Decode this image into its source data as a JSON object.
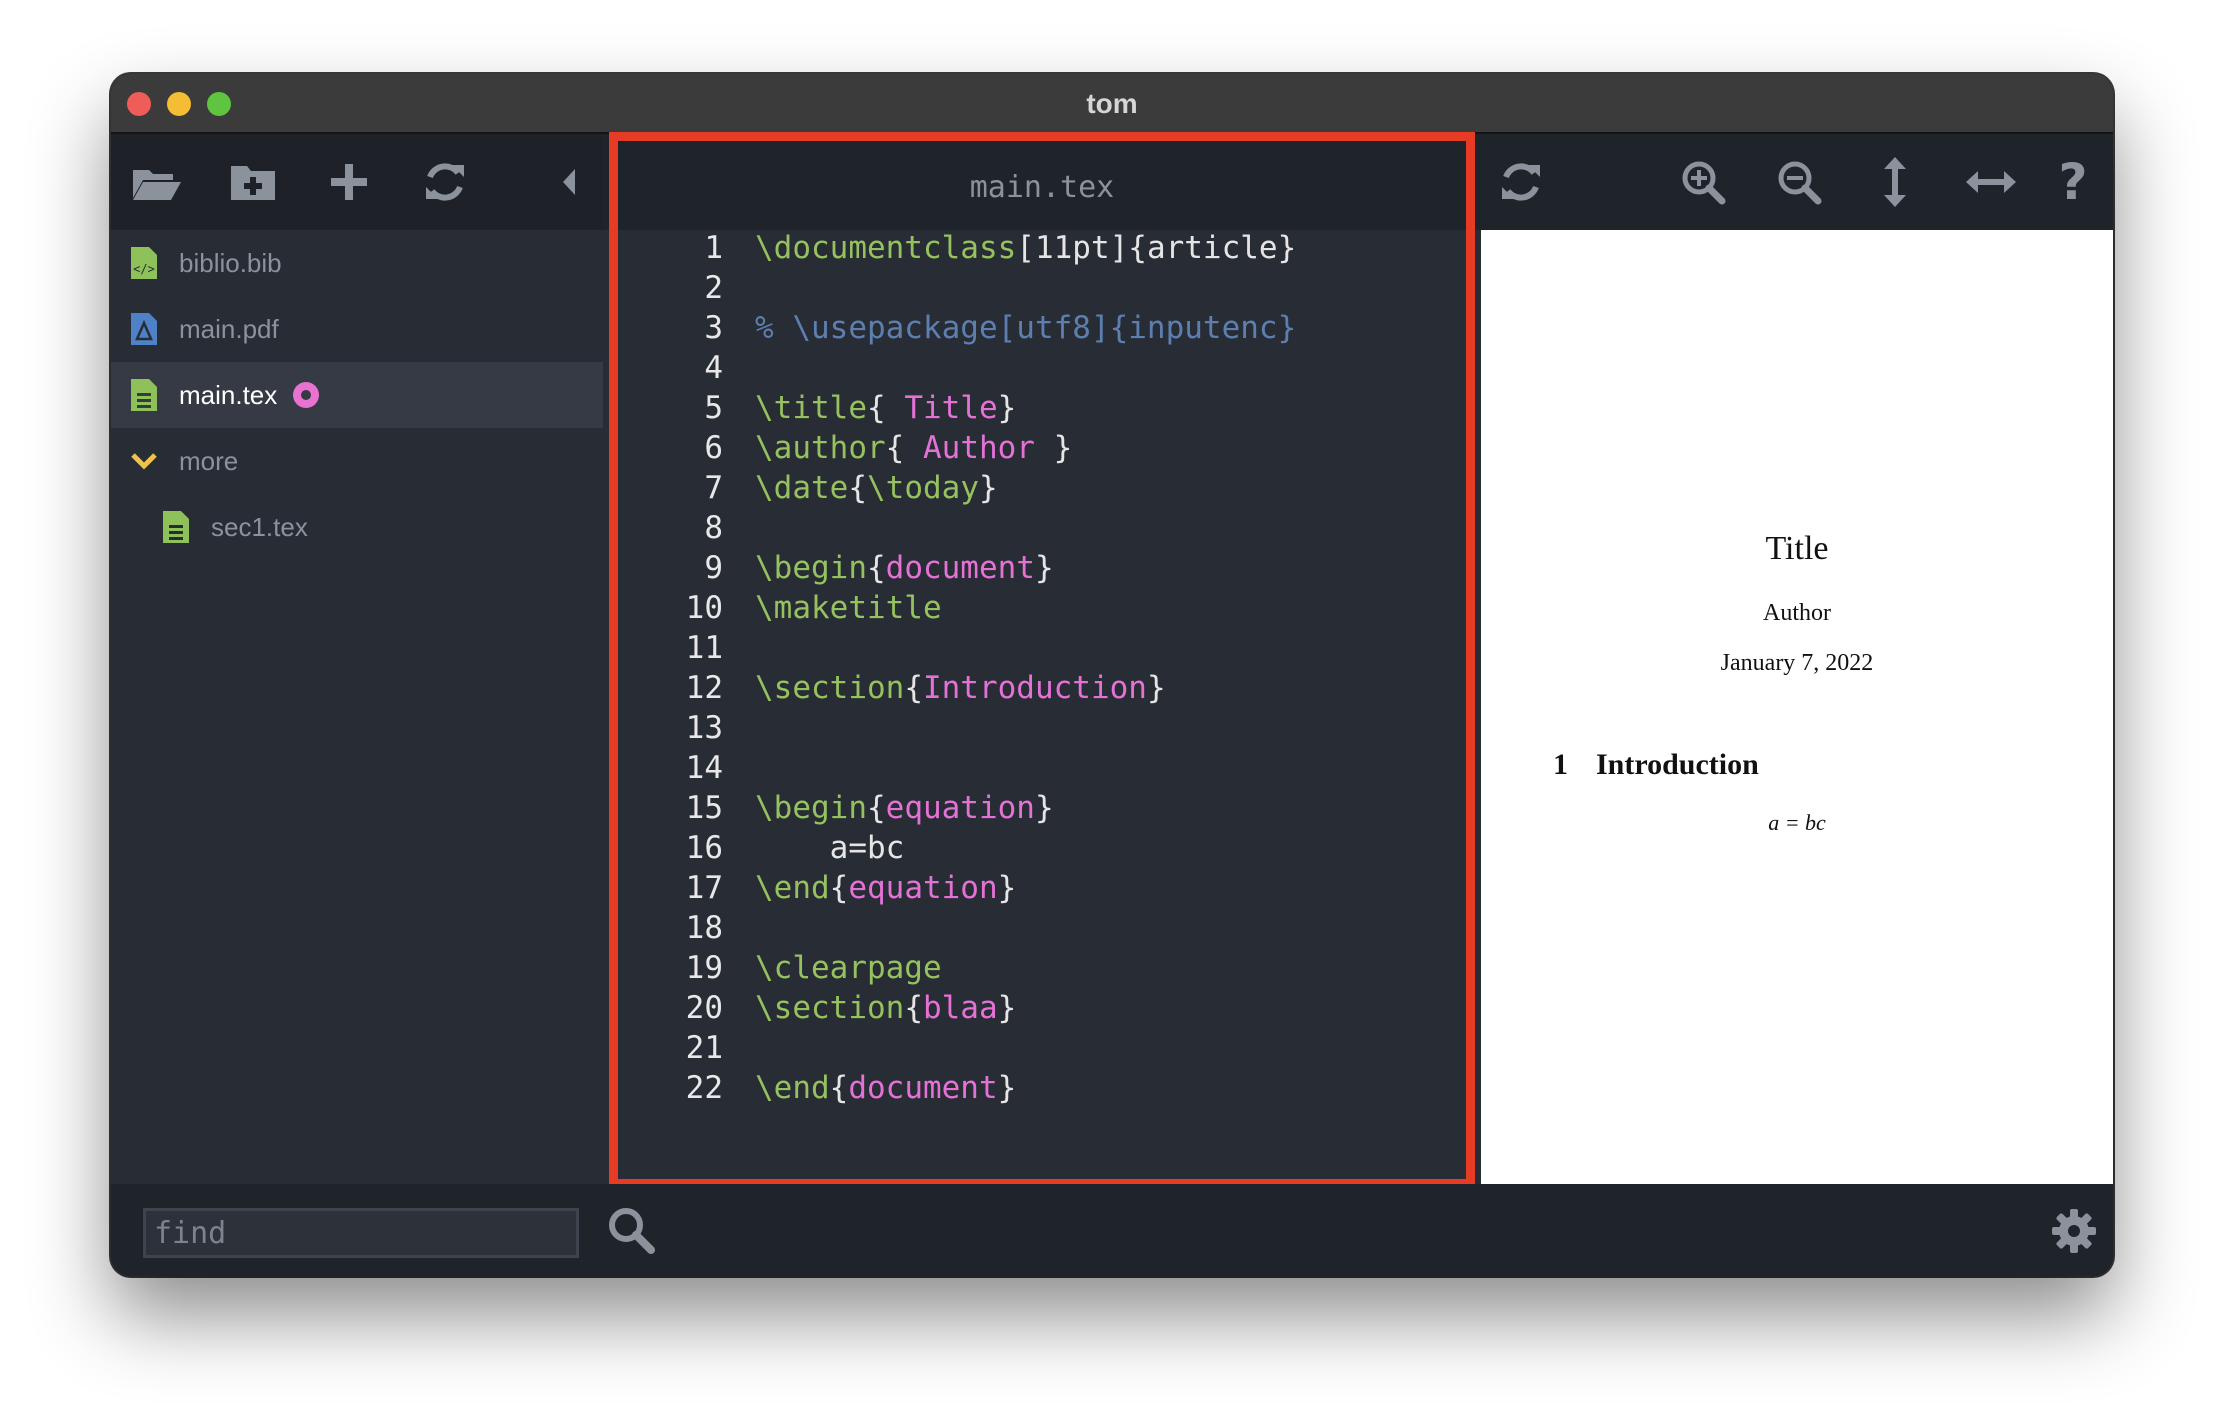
{
  "window": {
    "title": "tom"
  },
  "sidebar": {
    "toolbar": [
      {
        "name": "open-folder-icon"
      },
      {
        "name": "add-folder-icon"
      },
      {
        "name": "add-icon"
      },
      {
        "name": "refresh-icon"
      },
      {
        "name": "collapse-arrow-icon"
      }
    ],
    "files": [
      {
        "label": "biblio.bib",
        "icon": "bib-file-icon",
        "color": "#8fc15a"
      },
      {
        "label": "main.pdf",
        "icon": "pdf-file-icon",
        "color": "#4f81c7"
      },
      {
        "label": "main.tex",
        "icon": "tex-file-icon",
        "color": "#8fc15a",
        "active": true,
        "modified": true
      },
      {
        "label": "more",
        "icon": "chevron-down-icon",
        "color": "#f0c14b"
      },
      {
        "label": "sec1.tex",
        "icon": "tex-file-icon",
        "color": "#8fc15a"
      }
    ]
  },
  "editor": {
    "tab": "main.tex",
    "lines": [
      "1",
      "2",
      "3",
      "4",
      "5",
      "6",
      "7",
      "8",
      "9",
      "10",
      "11",
      "12",
      "13",
      "14",
      "15",
      "16",
      "17",
      "18",
      "19",
      "20",
      "21",
      "22"
    ],
    "code": {
      "l1": [
        "\\documentclass",
        "[11pt]{article}"
      ],
      "l3": "% \\usepackage[utf8]{inputenc}",
      "l5": [
        "\\title",
        "{",
        " Title",
        "}"
      ],
      "l6": [
        "\\author",
        "{",
        " Author",
        " }"
      ],
      "l7": [
        "\\date",
        "{",
        "\\today",
        "}"
      ],
      "l9": [
        "\\begin",
        "{",
        "document",
        "}"
      ],
      "l10": "\\maketitle",
      "l12": [
        "\\section",
        "{",
        "Introduction",
        "}"
      ],
      "l15": [
        "\\begin",
        "{",
        "equation",
        "}"
      ],
      "l16": "    a=bc",
      "l17": [
        "\\end",
        "{",
        "equation",
        "}"
      ],
      "l19": "\\clearpage",
      "l20": [
        "\\section",
        "{",
        "blaa",
        "}"
      ],
      "l22": [
        "\\end",
        "{",
        "document",
        "}"
      ]
    }
  },
  "preview": {
    "toolbar": [
      {
        "name": "refresh-preview-icon"
      },
      {
        "name": "zoom-in-icon"
      },
      {
        "name": "zoom-out-icon"
      },
      {
        "name": "fit-height-icon"
      },
      {
        "name": "fit-width-icon"
      },
      {
        "name": "help-icon"
      }
    ],
    "pdf": {
      "title": "Title",
      "author": "Author",
      "date": "January 7, 2022",
      "section_number": "1",
      "section_title": "Introduction",
      "equation": "a = bc"
    }
  },
  "bottombar": {
    "find_placeholder": "find"
  },
  "colors": {
    "highlight": "#e63c26",
    "command": "#95c15f",
    "argument": "#e472d6",
    "comment": "#5c7fb0"
  }
}
